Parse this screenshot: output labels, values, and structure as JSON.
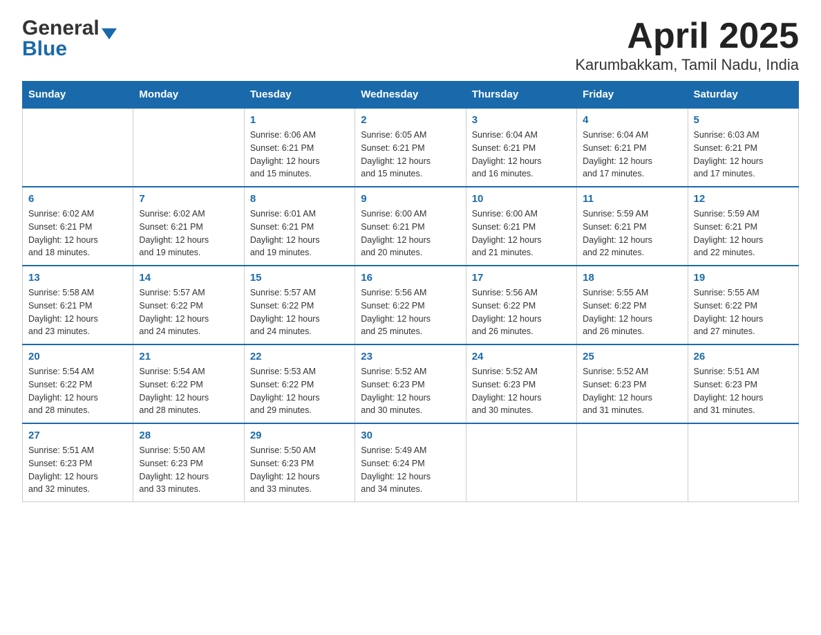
{
  "header": {
    "logo_general": "General",
    "logo_blue": "Blue",
    "title": "April 2025",
    "subtitle": "Karumbakkam, Tamil Nadu, India"
  },
  "calendar": {
    "days_of_week": [
      "Sunday",
      "Monday",
      "Tuesday",
      "Wednesday",
      "Thursday",
      "Friday",
      "Saturday"
    ],
    "weeks": [
      [
        {
          "day": "",
          "info": ""
        },
        {
          "day": "",
          "info": ""
        },
        {
          "day": "1",
          "info": "Sunrise: 6:06 AM\nSunset: 6:21 PM\nDaylight: 12 hours\nand 15 minutes."
        },
        {
          "day": "2",
          "info": "Sunrise: 6:05 AM\nSunset: 6:21 PM\nDaylight: 12 hours\nand 15 minutes."
        },
        {
          "day": "3",
          "info": "Sunrise: 6:04 AM\nSunset: 6:21 PM\nDaylight: 12 hours\nand 16 minutes."
        },
        {
          "day": "4",
          "info": "Sunrise: 6:04 AM\nSunset: 6:21 PM\nDaylight: 12 hours\nand 17 minutes."
        },
        {
          "day": "5",
          "info": "Sunrise: 6:03 AM\nSunset: 6:21 PM\nDaylight: 12 hours\nand 17 minutes."
        }
      ],
      [
        {
          "day": "6",
          "info": "Sunrise: 6:02 AM\nSunset: 6:21 PM\nDaylight: 12 hours\nand 18 minutes."
        },
        {
          "day": "7",
          "info": "Sunrise: 6:02 AM\nSunset: 6:21 PM\nDaylight: 12 hours\nand 19 minutes."
        },
        {
          "day": "8",
          "info": "Sunrise: 6:01 AM\nSunset: 6:21 PM\nDaylight: 12 hours\nand 19 minutes."
        },
        {
          "day": "9",
          "info": "Sunrise: 6:00 AM\nSunset: 6:21 PM\nDaylight: 12 hours\nand 20 minutes."
        },
        {
          "day": "10",
          "info": "Sunrise: 6:00 AM\nSunset: 6:21 PM\nDaylight: 12 hours\nand 21 minutes."
        },
        {
          "day": "11",
          "info": "Sunrise: 5:59 AM\nSunset: 6:21 PM\nDaylight: 12 hours\nand 22 minutes."
        },
        {
          "day": "12",
          "info": "Sunrise: 5:59 AM\nSunset: 6:21 PM\nDaylight: 12 hours\nand 22 minutes."
        }
      ],
      [
        {
          "day": "13",
          "info": "Sunrise: 5:58 AM\nSunset: 6:21 PM\nDaylight: 12 hours\nand 23 minutes."
        },
        {
          "day": "14",
          "info": "Sunrise: 5:57 AM\nSunset: 6:22 PM\nDaylight: 12 hours\nand 24 minutes."
        },
        {
          "day": "15",
          "info": "Sunrise: 5:57 AM\nSunset: 6:22 PM\nDaylight: 12 hours\nand 24 minutes."
        },
        {
          "day": "16",
          "info": "Sunrise: 5:56 AM\nSunset: 6:22 PM\nDaylight: 12 hours\nand 25 minutes."
        },
        {
          "day": "17",
          "info": "Sunrise: 5:56 AM\nSunset: 6:22 PM\nDaylight: 12 hours\nand 26 minutes."
        },
        {
          "day": "18",
          "info": "Sunrise: 5:55 AM\nSunset: 6:22 PM\nDaylight: 12 hours\nand 26 minutes."
        },
        {
          "day": "19",
          "info": "Sunrise: 5:55 AM\nSunset: 6:22 PM\nDaylight: 12 hours\nand 27 minutes."
        }
      ],
      [
        {
          "day": "20",
          "info": "Sunrise: 5:54 AM\nSunset: 6:22 PM\nDaylight: 12 hours\nand 28 minutes."
        },
        {
          "day": "21",
          "info": "Sunrise: 5:54 AM\nSunset: 6:22 PM\nDaylight: 12 hours\nand 28 minutes."
        },
        {
          "day": "22",
          "info": "Sunrise: 5:53 AM\nSunset: 6:22 PM\nDaylight: 12 hours\nand 29 minutes."
        },
        {
          "day": "23",
          "info": "Sunrise: 5:52 AM\nSunset: 6:23 PM\nDaylight: 12 hours\nand 30 minutes."
        },
        {
          "day": "24",
          "info": "Sunrise: 5:52 AM\nSunset: 6:23 PM\nDaylight: 12 hours\nand 30 minutes."
        },
        {
          "day": "25",
          "info": "Sunrise: 5:52 AM\nSunset: 6:23 PM\nDaylight: 12 hours\nand 31 minutes."
        },
        {
          "day": "26",
          "info": "Sunrise: 5:51 AM\nSunset: 6:23 PM\nDaylight: 12 hours\nand 31 minutes."
        }
      ],
      [
        {
          "day": "27",
          "info": "Sunrise: 5:51 AM\nSunset: 6:23 PM\nDaylight: 12 hours\nand 32 minutes."
        },
        {
          "day": "28",
          "info": "Sunrise: 5:50 AM\nSunset: 6:23 PM\nDaylight: 12 hours\nand 33 minutes."
        },
        {
          "day": "29",
          "info": "Sunrise: 5:50 AM\nSunset: 6:23 PM\nDaylight: 12 hours\nand 33 minutes."
        },
        {
          "day": "30",
          "info": "Sunrise: 5:49 AM\nSunset: 6:24 PM\nDaylight: 12 hours\nand 34 minutes."
        },
        {
          "day": "",
          "info": ""
        },
        {
          "day": "",
          "info": ""
        },
        {
          "day": "",
          "info": ""
        }
      ]
    ]
  }
}
